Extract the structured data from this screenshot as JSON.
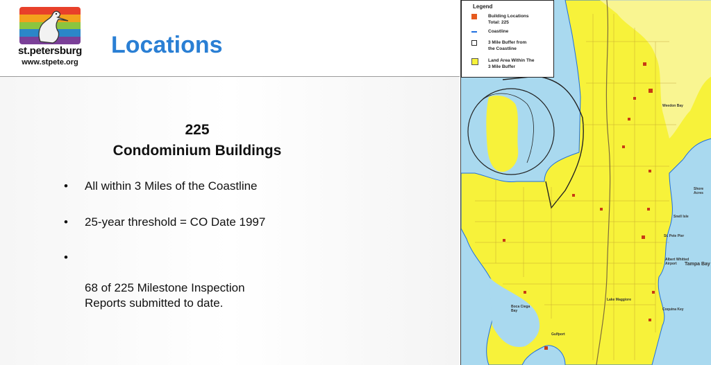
{
  "header": {
    "logo": {
      "name": "st.petersburg",
      "url": "www.stpete.org",
      "stripe_colors": [
        "#e8402a",
        "#f3a21c",
        "#8bc53f",
        "#2b86c8",
        "#7a3f98"
      ]
    },
    "title": "Locations"
  },
  "content": {
    "count": "225",
    "subtitle": "Condominium Buildings",
    "bullets": [
      {
        "marker": "•",
        "text": "All within 3 Miles of the Coastline"
      },
      {
        "marker": "•",
        "text": "25-year threshold = CO Date 1997"
      },
      {
        "marker": "•",
        "text": "68 of 225 Milestone Inspection\nReports submitted to date."
      }
    ]
  },
  "map": {
    "legend": {
      "title": "Legend",
      "items": [
        {
          "text": "Building Locations\nTotal: 225",
          "swatch": "#e65a1e"
        },
        {
          "text": "Coastline",
          "swatch": "#1f6fe0"
        },
        {
          "text": "3 Mile Buffer from\nthe Coastline",
          "swatch": "#ffffff"
        },
        {
          "text": "Land Area Within The\n3 Mile Buffer",
          "swatch": "#f7f23a"
        }
      ]
    },
    "place_labels": [
      "Weedon Bay",
      "Snell Isle",
      "Shore Acres",
      "St. Pete Pier",
      "Albert Whitted Airport",
      "Tampa Bay",
      "Lake Maggiore",
      "Coquina Key",
      "Boca Ciega Bay",
      "Gulfport"
    ],
    "colors": {
      "water": "#a9d9ef",
      "land": "#f7f23a",
      "buffer_outline": "#222222",
      "building": "#c83a14"
    }
  }
}
